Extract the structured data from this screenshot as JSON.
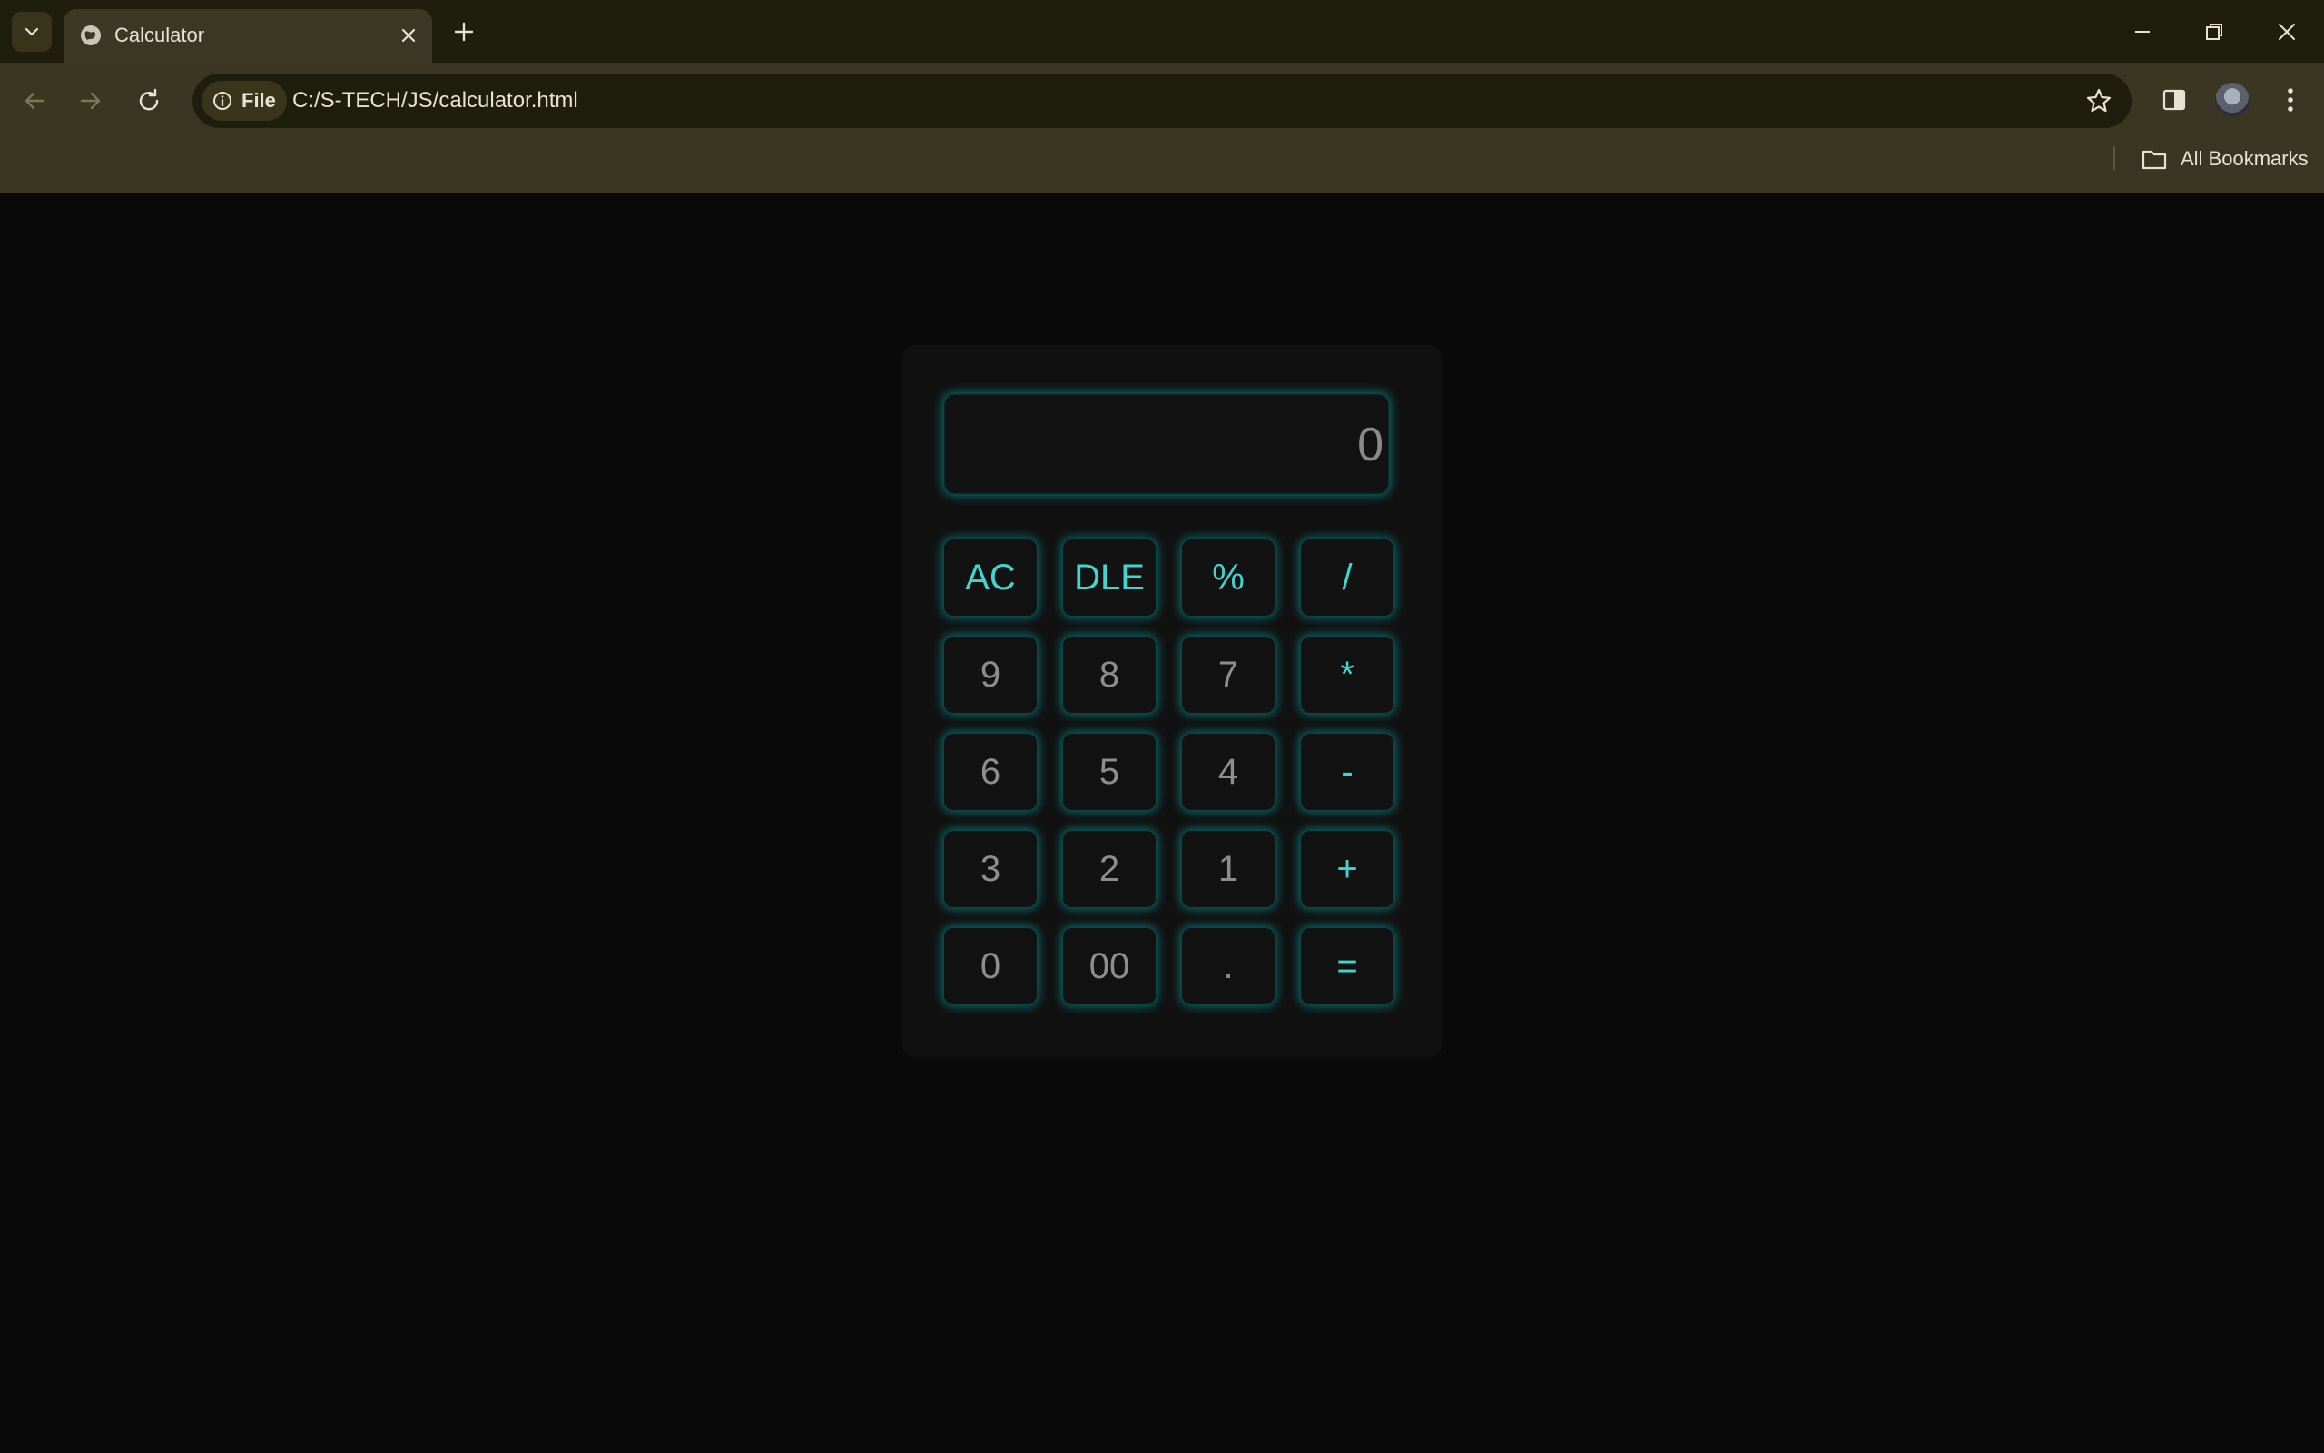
{
  "browser": {
    "tab": {
      "title": "Calculator"
    },
    "omnibox": {
      "scheme_label": "File",
      "url": "C:/S-TECH/JS/calculator.html"
    },
    "bookmarks": {
      "label": "All Bookmarks"
    }
  },
  "calculator": {
    "display": "0",
    "keys": [
      [
        "AC",
        "DLE",
        "%",
        "/"
      ],
      [
        "9",
        "8",
        "7",
        "*"
      ],
      [
        "6",
        "5",
        "4",
        "-"
      ],
      [
        "3",
        "2",
        "1",
        "+"
      ],
      [
        "0",
        "00",
        ".",
        "="
      ]
    ]
  },
  "colors": {
    "accent": "#3ed6cf",
    "digit_text": "#8e8e8e",
    "chrome_bg": "#3b3622",
    "tabstrip_bg": "#1f1d0c"
  }
}
